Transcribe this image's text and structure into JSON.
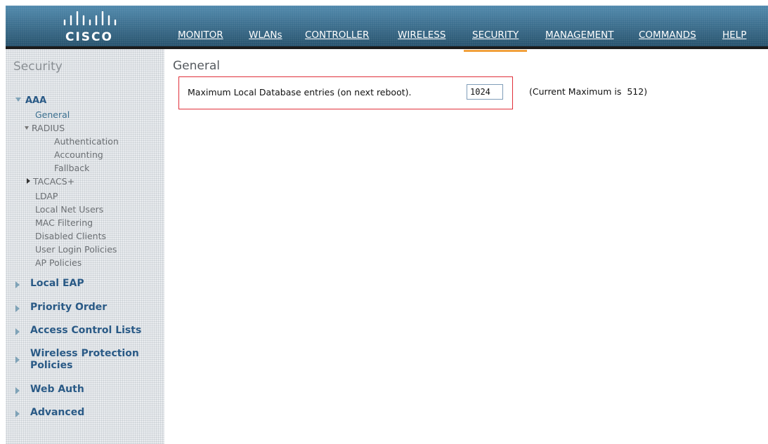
{
  "brand": {
    "name": "CISCO"
  },
  "nav": {
    "items": [
      {
        "label": "MONITOR"
      },
      {
        "label": "WLANs"
      },
      {
        "label": "CONTROLLER"
      },
      {
        "label": "WIRELESS"
      },
      {
        "label": "SECURITY",
        "active": true
      },
      {
        "label": "MANAGEMENT"
      },
      {
        "label": "COMMANDS"
      },
      {
        "label": "HELP"
      }
    ],
    "active_color": "#f0a03c"
  },
  "sidebar": {
    "title": "Security",
    "aaa": {
      "label": "AAA",
      "items": {
        "general": "General",
        "radius": "RADIUS",
        "authentication": "Authentication",
        "accounting": "Accounting",
        "fallback": "Fallback",
        "tacacs": "TACACS+",
        "ldap": "LDAP",
        "local_net_users": "Local Net Users",
        "mac_filtering": "MAC Filtering",
        "disabled_clients": "Disabled Clients",
        "user_login_policies": "User Login Policies",
        "ap_policies": "AP Policies"
      }
    },
    "sections": [
      {
        "label": "Local EAP"
      },
      {
        "label": "Priority Order"
      },
      {
        "label": "Access Control Lists"
      },
      {
        "label": "Wireless Protection Policies"
      },
      {
        "label": "Web Auth"
      },
      {
        "label": "Advanced"
      }
    ]
  },
  "main": {
    "title": "General",
    "field_label": "Maximum Local Database entries (on next reboot).",
    "field_value": "1024",
    "current_max_label": "(Current Maximum is",
    "current_max_value": "512)"
  },
  "colors": {
    "header": "#3a6f8f",
    "highlight_border": "#e0303a",
    "sidebar_link": "#2a5a86"
  }
}
